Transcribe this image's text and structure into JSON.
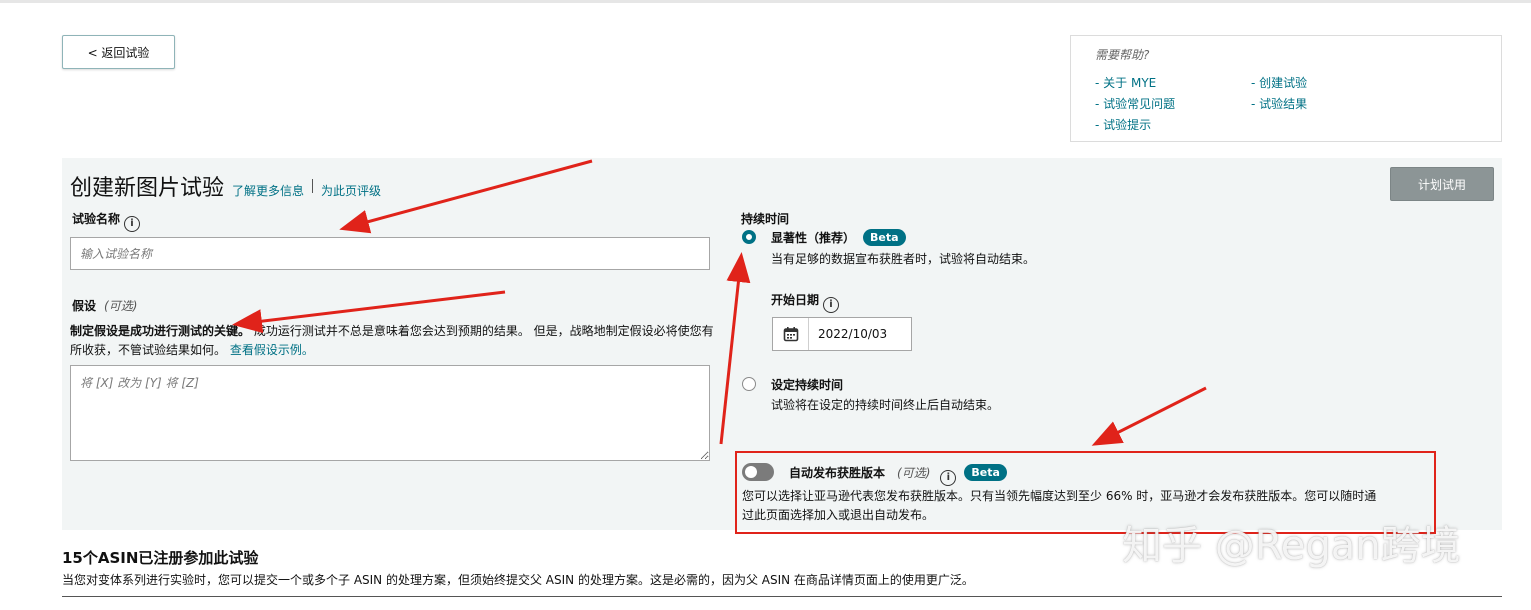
{
  "back_button": {
    "label": "< 返回试验"
  },
  "help": {
    "title": "需要帮助?",
    "links": [
      "- 关于 MYE",
      "- 试验常见问题",
      "- 试验提示",
      "- 创建试验",
      "- 试验结果"
    ]
  },
  "header": {
    "title": "创建新图片试验",
    "learn_more": "了解更多信息",
    "rate_page": "为此页评级",
    "plan_button": "计划试用"
  },
  "experiment_name": {
    "label": "试验名称",
    "placeholder": "输入试验名称",
    "value": ""
  },
  "hypothesis": {
    "label": "假设",
    "optional": "(可选)",
    "desc_bold": "制定假设是成功进行测试的关键。",
    "desc_text": " 成功运行测试并不总是意味着您会达到预期的结果。 但是，战略地制定假设必将使您有所收获，不管试验结果如何。",
    "example_link": "查看假设示例。",
    "placeholder": "将 [X] 改为 [Y] 将 [Z]",
    "value": ""
  },
  "duration": {
    "label": "持续时间",
    "option1": {
      "title": "显著性（推荐）",
      "badge": "Beta",
      "desc": "当有足够的数据宣布获胜者时，试验将自动结束。",
      "selected": true
    },
    "start_date_label": "开始日期",
    "start_date": "2022/10/03",
    "option2": {
      "title": "设定持续时间",
      "desc": "试验将在设定的持续时间终止后自动结束。",
      "selected": false
    }
  },
  "auto_publish": {
    "title": "自动发布获胜版本",
    "optional": "(可选)",
    "badge": "Beta",
    "enabled": false,
    "desc": "您可以选择让亚马逊代表您发布获胜版本。只有当领先幅度达到至少 66% 时，亚马逊才会发布获胜版本。您可以随时通过此页面选择加入或退出自动发布。"
  },
  "asin": {
    "title": "15个ASIN已注册参加此试验",
    "desc": "当您对变体系列进行实验时，您可以提交一个或多个子 ASIN 的处理方案，但须始终提交父 ASIN 的处理方案。这是必需的，因为父 ASIN 在商品详情页面上的使用更广泛。"
  },
  "watermark": "知乎 @Regan跨境",
  "colors": {
    "accent": "#007185",
    "annotation": "#e0231a",
    "panel": "#f2f5f5"
  }
}
